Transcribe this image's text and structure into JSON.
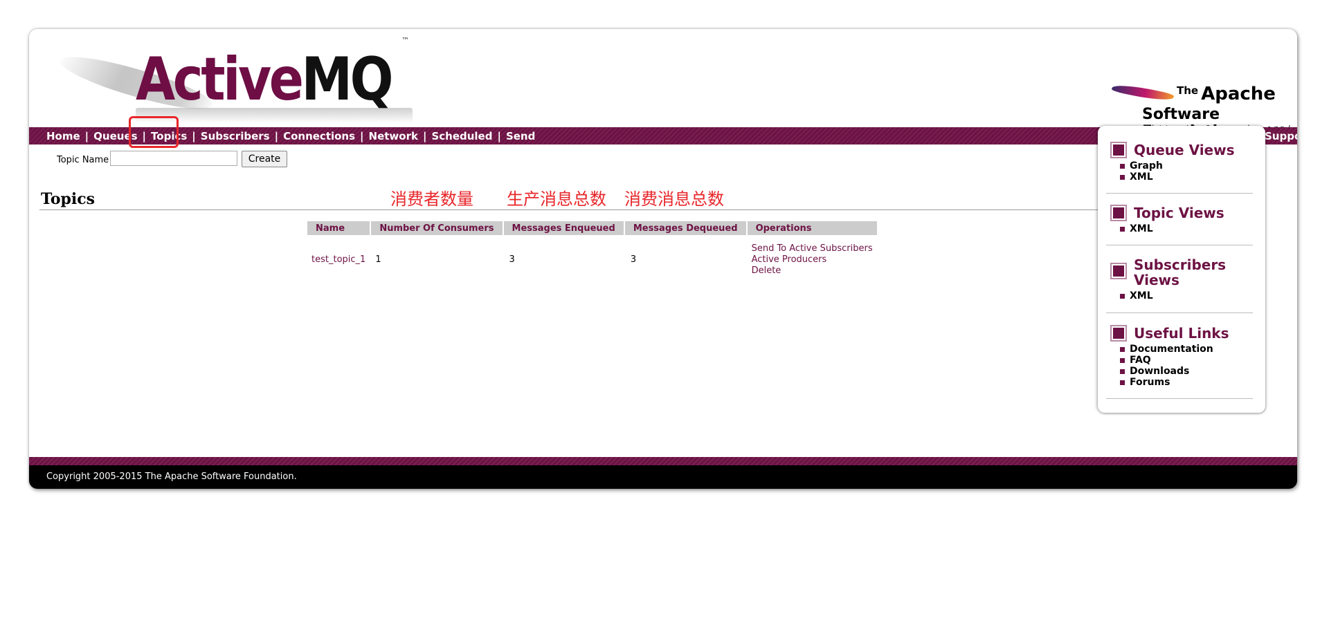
{
  "header": {
    "logo_part1": "Active",
    "logo_part2": "MQ",
    "trademark": "™",
    "apache_the": "The",
    "apache_name": "Apache",
    "apache_foundation": "Software Foundation",
    "apache_url": "http://www.apache.org/"
  },
  "nav": {
    "items": [
      "Home",
      "Queues",
      "Topics",
      "Subscribers",
      "Connections",
      "Network",
      "Scheduled",
      "Send"
    ],
    "separator": "|",
    "support": "Support",
    "active": "Topics"
  },
  "form": {
    "label": "Topic Name",
    "value": "",
    "button": "Create"
  },
  "page_title": "Topics",
  "annotations": {
    "consumers": "消费者数量",
    "enqueued": "生产消息总数",
    "dequeued": "消费消息总数"
  },
  "table": {
    "headers": [
      "Name",
      "Number Of Consumers",
      "Messages Enqueued",
      "Messages Dequeued",
      "Operations"
    ],
    "rows": [
      {
        "name": "test_topic_1",
        "consumers": "1",
        "enqueued": "3",
        "dequeued": "3",
        "operations": [
          "Send To Active Subscribers",
          "Active Producers",
          "Delete"
        ]
      }
    ]
  },
  "sidebar": {
    "queue_views": {
      "title": "Queue Views",
      "items": [
        "Graph",
        "XML"
      ]
    },
    "topic_views": {
      "title": "Topic Views",
      "items": [
        "XML"
      ]
    },
    "subscribers_views": {
      "title_line1": "Subscribers",
      "title_line2": "Views",
      "items": [
        "XML"
      ]
    },
    "useful_links": {
      "title": "Useful Links",
      "items": [
        "Documentation",
        "FAQ",
        "Downloads",
        "Forums"
      ]
    }
  },
  "footer": {
    "copyright": "Copyright 2005-2015 The Apache Software Foundation."
  },
  "colors": {
    "brand": "#6d1244",
    "annotation": "#e8262a"
  }
}
